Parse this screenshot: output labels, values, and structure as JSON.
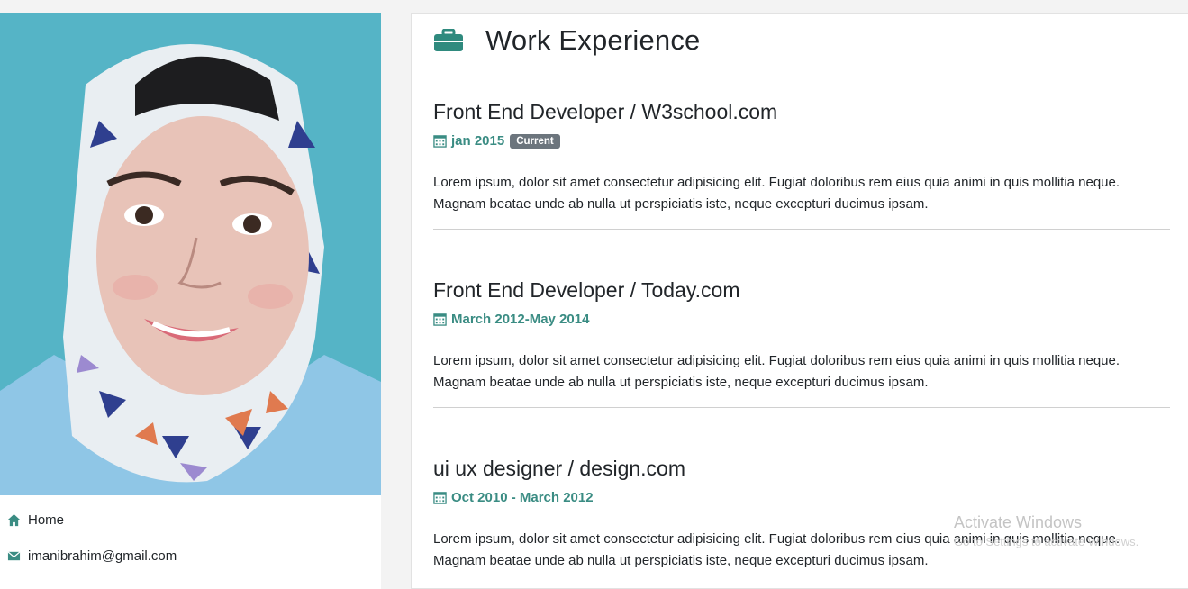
{
  "profile": {
    "photo_alt": "profile-photo",
    "contacts": [
      {
        "icon": "home-icon",
        "label": "Home"
      },
      {
        "icon": "envelope-icon",
        "label": "imanibrahim@gmail.com"
      }
    ]
  },
  "experience": {
    "icon": "briefcase-icon",
    "title": "Work Experience",
    "jobs": [
      {
        "title": "Front End Developer / W3school.com",
        "date": "jan 2015",
        "badge": "Current",
        "description": "Lorem ipsum, dolor sit amet consectetur adipisicing elit. Fugiat doloribus rem eius quia animi in quis mollitia neque. Magnam beatae unde ab nulla ut perspiciatis iste, neque excepturi ducimus ipsam."
      },
      {
        "title": "Front End Developer / Today.com",
        "date": "March 2012-May 2014",
        "description": "Lorem ipsum, dolor sit amet consectetur adipisicing elit. Fugiat doloribus rem eius quia animi in quis mollitia neque. Magnam beatae unde ab nulla ut perspiciatis iste, neque excepturi ducimus ipsam."
      },
      {
        "title": "ui ux designer / design.com",
        "date": "Oct 2010 - March 2012",
        "description": "Lorem ipsum, dolor sit amet consectetur adipisicing elit. Fugiat doloribus rem eius quia animi in quis mollitia neque. Magnam beatae unde ab nulla ut perspiciatis iste, neque excepturi ducimus ipsam."
      }
    ]
  },
  "watermark": {
    "line1": "Activate Windows",
    "line2": "Go to Settings to activate Windows."
  },
  "colors": {
    "accent": "#3a8c83",
    "badge": "#6c757d",
    "photo_bg": "#55b4c6"
  }
}
